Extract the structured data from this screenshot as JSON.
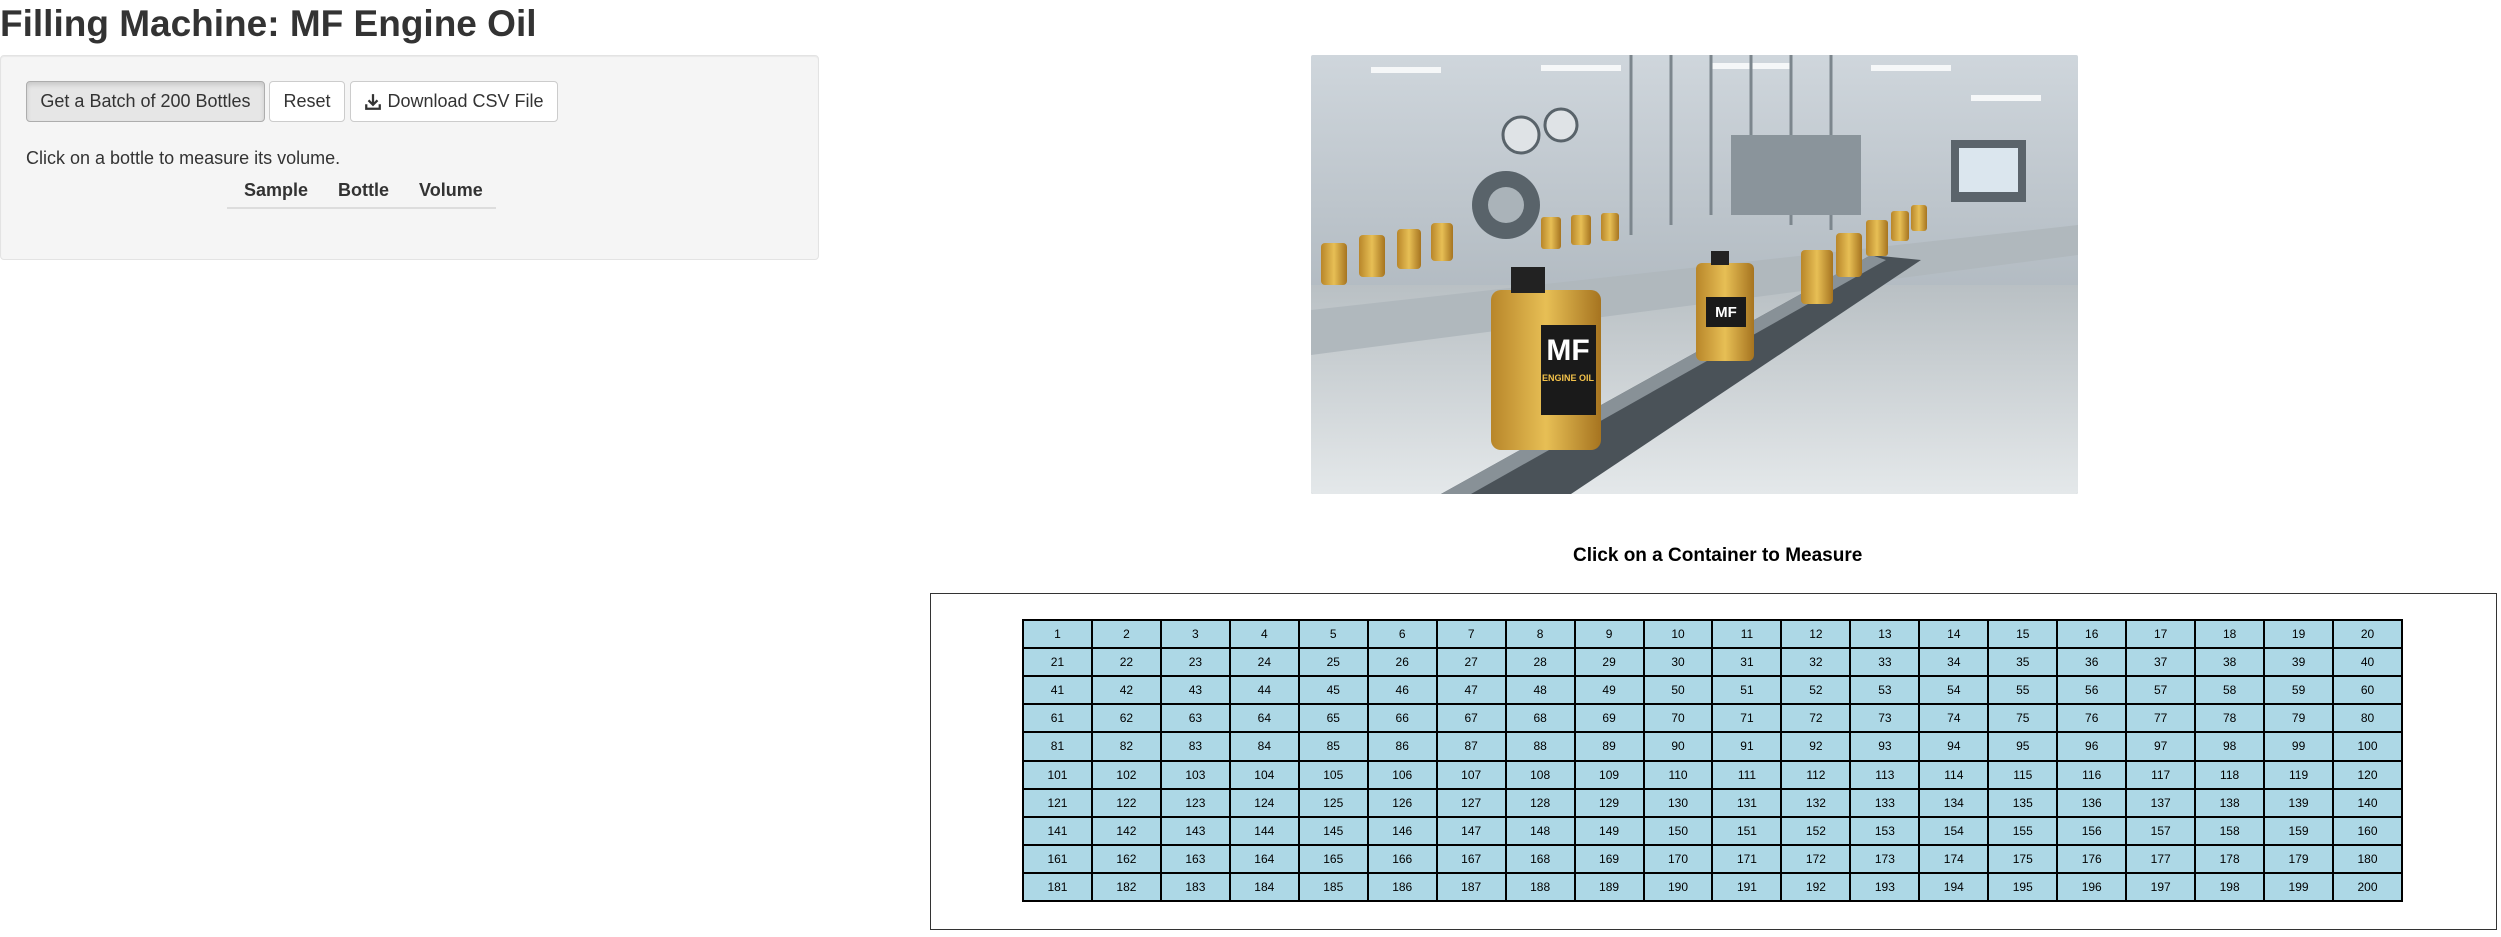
{
  "page": {
    "title": "Filling Machine: MF Engine Oil"
  },
  "sidebar": {
    "batch_button": "Get a Batch of 200 Bottles",
    "reset_button": "Reset",
    "download_button": "Download CSV File",
    "download_icon": "download-icon",
    "hint": "Click on a bottle to measure its volume.",
    "table_headers": [
      "Sample",
      "Bottle",
      "Volume"
    ]
  },
  "photo": {
    "bottle_label_top": "MF",
    "bottle_label_bottom": "ENGINE OIL"
  },
  "grid": {
    "title": "Click on a Container to Measure",
    "cell_color": "#add8e6",
    "rows": 10,
    "cols": 20,
    "cells": [
      "1",
      "2",
      "3",
      "4",
      "5",
      "6",
      "7",
      "8",
      "9",
      "10",
      "11",
      "12",
      "13",
      "14",
      "15",
      "16",
      "17",
      "18",
      "19",
      "20",
      "21",
      "22",
      "23",
      "24",
      "25",
      "26",
      "27",
      "28",
      "29",
      "30",
      "31",
      "32",
      "33",
      "34",
      "35",
      "36",
      "37",
      "38",
      "39",
      "40",
      "41",
      "42",
      "43",
      "44",
      "45",
      "46",
      "47",
      "48",
      "49",
      "50",
      "51",
      "52",
      "53",
      "54",
      "55",
      "56",
      "57",
      "58",
      "59",
      "60",
      "61",
      "62",
      "63",
      "64",
      "65",
      "66",
      "67",
      "68",
      "69",
      "70",
      "71",
      "72",
      "73",
      "74",
      "75",
      "76",
      "77",
      "78",
      "79",
      "80",
      "81",
      "82",
      "83",
      "84",
      "85",
      "86",
      "87",
      "88",
      "89",
      "90",
      "91",
      "92",
      "93",
      "94",
      "95",
      "96",
      "97",
      "98",
      "99",
      "100",
      "101",
      "102",
      "103",
      "104",
      "105",
      "106",
      "107",
      "108",
      "109",
      "110",
      "111",
      "112",
      "113",
      "114",
      "115",
      "116",
      "117",
      "118",
      "119",
      "120",
      "121",
      "122",
      "123",
      "124",
      "125",
      "126",
      "127",
      "128",
      "129",
      "130",
      "131",
      "132",
      "133",
      "134",
      "135",
      "136",
      "137",
      "138",
      "139",
      "140",
      "141",
      "142",
      "143",
      "144",
      "145",
      "146",
      "147",
      "148",
      "149",
      "150",
      "151",
      "152",
      "153",
      "154",
      "155",
      "156",
      "157",
      "158",
      "159",
      "160",
      "161",
      "162",
      "163",
      "164",
      "165",
      "166",
      "167",
      "168",
      "169",
      "170",
      "171",
      "172",
      "173",
      "174",
      "175",
      "176",
      "177",
      "178",
      "179",
      "180",
      "181",
      "182",
      "183",
      "184",
      "185",
      "186",
      "187",
      "188",
      "189",
      "190",
      "191",
      "192",
      "193",
      "194",
      "195",
      "196",
      "197",
      "198",
      "199",
      "200"
    ]
  }
}
